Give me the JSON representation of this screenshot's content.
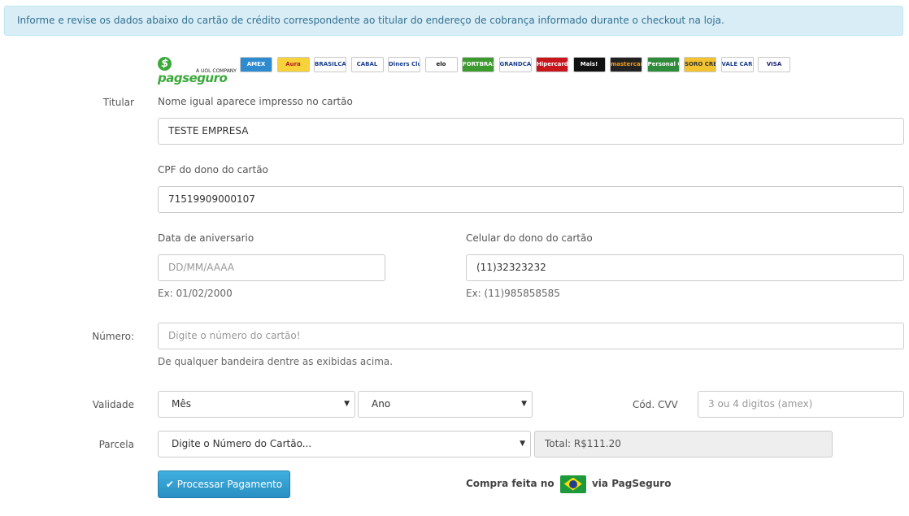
{
  "alert": {
    "text": "Informe e revise os dados abaixo do cartão de crédito correspondente ao titular do endereço de cobrança informado durante o checkout na loja."
  },
  "logo": {
    "name": "pagseguro",
    "subtitle": "A UOL COMPANY",
    "icon": "pagseguro-logo-icon"
  },
  "brands": [
    {
      "name": "AMEX",
      "bg": "#2f8bd0",
      "fg": "#ffffff"
    },
    {
      "name": "Aura",
      "bg": "#f7d23b",
      "fg": "#b01e1e"
    },
    {
      "name": "BRASILCARD",
      "bg": "#ffffff",
      "fg": "#1b3f8c"
    },
    {
      "name": "CABAL",
      "bg": "#ffffff",
      "fg": "#1b3f8c"
    },
    {
      "name": "Diners Club",
      "bg": "#ffffff",
      "fg": "#1b3f8c"
    },
    {
      "name": "elo",
      "bg": "#ffffff",
      "fg": "#111111"
    },
    {
      "name": "FORTBRASIL",
      "bg": "#3c9a2e",
      "fg": "#ffffff"
    },
    {
      "name": "GRANDCARD",
      "bg": "#ffffff",
      "fg": "#1b3f8c"
    },
    {
      "name": "Hipercard",
      "bg": "#c8161d",
      "fg": "#ffffff"
    },
    {
      "name": "Mais!",
      "bg": "#111111",
      "fg": "#ffffff"
    },
    {
      "name": "mastercard",
      "bg": "#222222",
      "fg": "#f79e1b"
    },
    {
      "name": "Personal Card",
      "bg": "#2e8b3a",
      "fg": "#ffffff"
    },
    {
      "name": "SORO CRED",
      "bg": "#f2c230",
      "fg": "#333333"
    },
    {
      "name": "VALE CARD",
      "bg": "#ffffff",
      "fg": "#1b3f8c"
    },
    {
      "name": "VISA",
      "bg": "#ffffff",
      "fg": "#1a1f71"
    }
  ],
  "form": {
    "titular": {
      "label": "Titular",
      "hint": "Nome igual aparece impresso no cartão",
      "value": "TESTE EMPRESA"
    },
    "cpf": {
      "label": "CPF do dono do cartão",
      "value": "71519909000107"
    },
    "birth": {
      "label": "Data de aniversario",
      "placeholder": "DD/MM/AAAA",
      "help": "Ex: 01/02/2000"
    },
    "phone": {
      "label": "Celular do dono do cartão",
      "value": "(11)32323232",
      "help": "Ex: (11)985858585"
    },
    "number": {
      "label": "Número:",
      "placeholder": "Digite o número do cartão!",
      "help": "De qualquer bandeira dentre as exibidas acima."
    },
    "validity": {
      "label": "Validade",
      "month": "Mês",
      "year": "Ano"
    },
    "cvv": {
      "label": "Cód. CVV",
      "placeholder": "3 ou 4 digitos (amex)"
    },
    "installments": {
      "label": "Parcela",
      "selected": "Digite o Número do Cartão...",
      "total": "Total: R$111.20"
    }
  },
  "submit": {
    "label": "Processar Pagamento",
    "icon": "check-icon"
  },
  "footer": {
    "before": "Compra feita no",
    "after": "via PagSeguro",
    "flag_icon": "brazil-flag-icon"
  }
}
